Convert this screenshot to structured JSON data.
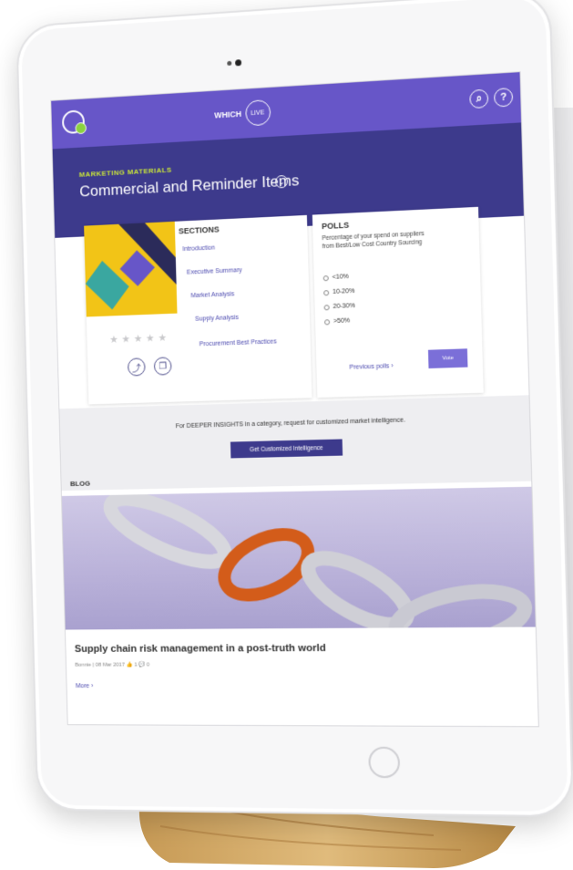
{
  "app": {
    "brand_text": "WHICH",
    "brand_ring_text": "LIVE"
  },
  "header": {
    "eyebrow": "MARKETING MATERIALS",
    "title": "Commercial and Reminder Items",
    "chevron": "⌄"
  },
  "toolbar": {
    "search_icon": "search-icon",
    "help_label": "?"
  },
  "sections": {
    "title": "SECTIONS",
    "items": [
      "Introduction",
      "Executive Summary",
      "Market Analysis",
      "Supply Analysis",
      "Procurement Best Practices"
    ]
  },
  "report": {
    "rating_stars": "★★★★★",
    "share_icon": "share-icon",
    "bookmark_icon": "bookmark-icon"
  },
  "polls": {
    "title": "POLLS",
    "question": "Percentage of your spend on suppliers from Best/Low Cost Country Sourcing",
    "options": [
      "<10%",
      "10-20%",
      "20-30%",
      ">50%"
    ],
    "previous_link": "Previous polls",
    "vote_label": "Vote"
  },
  "insights": {
    "text": "For DEEPER INSIGHTS in a category, request for customized market intelligence.",
    "button_label": "Get Customized Intelligence"
  },
  "blog": {
    "section_label": "BLOG",
    "post_title": "Supply chain risk management in a post-truth world",
    "author": "Bonnie",
    "date": "08 Mar 2017",
    "likes": "1",
    "comments": "0",
    "more_label": "More"
  },
  "colors": {
    "topbar": "#6756c8",
    "header": "#3d3a8c",
    "accent": "#c7e23a",
    "cover_yellow": "#f2c417"
  }
}
